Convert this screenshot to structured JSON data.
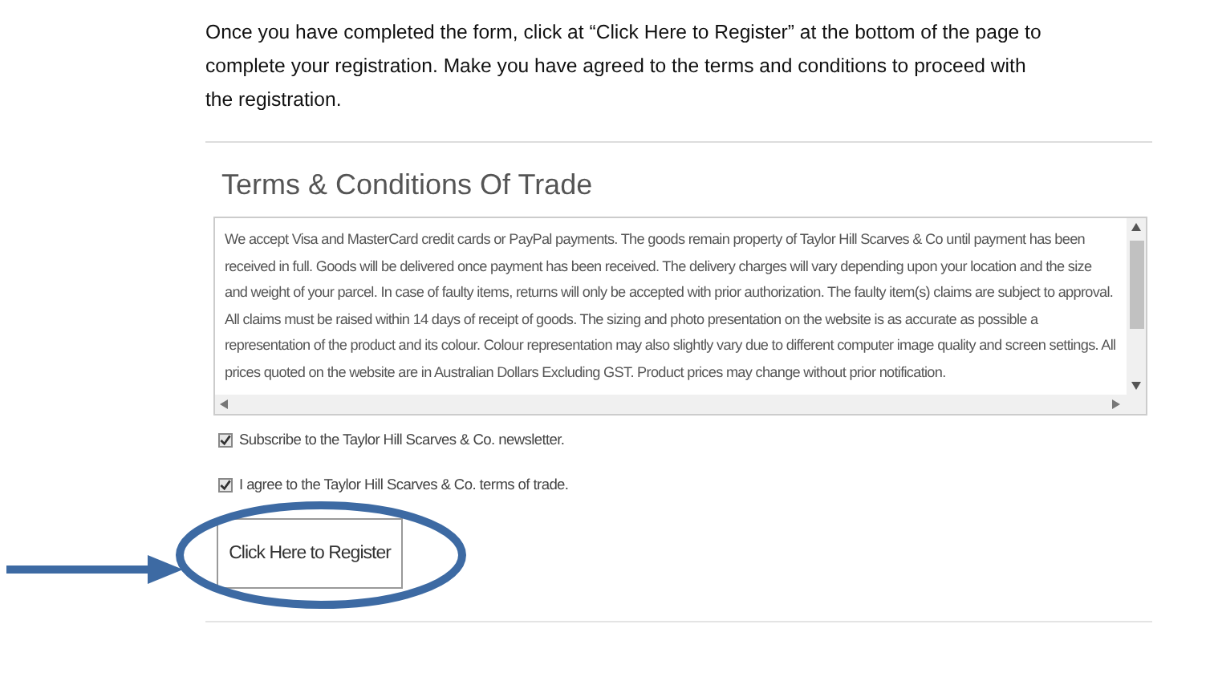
{
  "instruction": "Once you have completed the form, click at “Click Here to Register” at the bottom of the page to complete your registration. Make you have agreed to the terms and conditions to proceed with the registration.",
  "form": {
    "title": "Terms & Conditions Of Trade",
    "terms_text": "We accept Visa and MasterCard credit cards or PayPal payments. The goods remain property of Taylor Hill Scarves & Co until payment has been received in full. Goods will be delivered once payment has been received. The delivery charges will vary depending upon your location and the size and weight of your parcel. In case of faulty items, returns will only be accepted with prior authorization. The faulty item(s) claims are subject to approval. All claims must be raised within 14 days of receipt of goods. The sizing and photo presentation on the website is as accurate as possible a representation of the product and its colour. Colour representation may also slightly vary due to different computer image quality and screen settings. All prices quoted on the website are in Australian Dollars Excluding GST. Product prices may change without prior notification.",
    "checkboxes": [
      {
        "label": "Subscribe to the Taylor Hill Scarves & Co. newsletter.",
        "checked": true
      },
      {
        "label": "I agree to the Taylor Hill Scarves & Co. terms of trade.",
        "checked": true
      }
    ],
    "submit_button": "Click Here to Register"
  }
}
